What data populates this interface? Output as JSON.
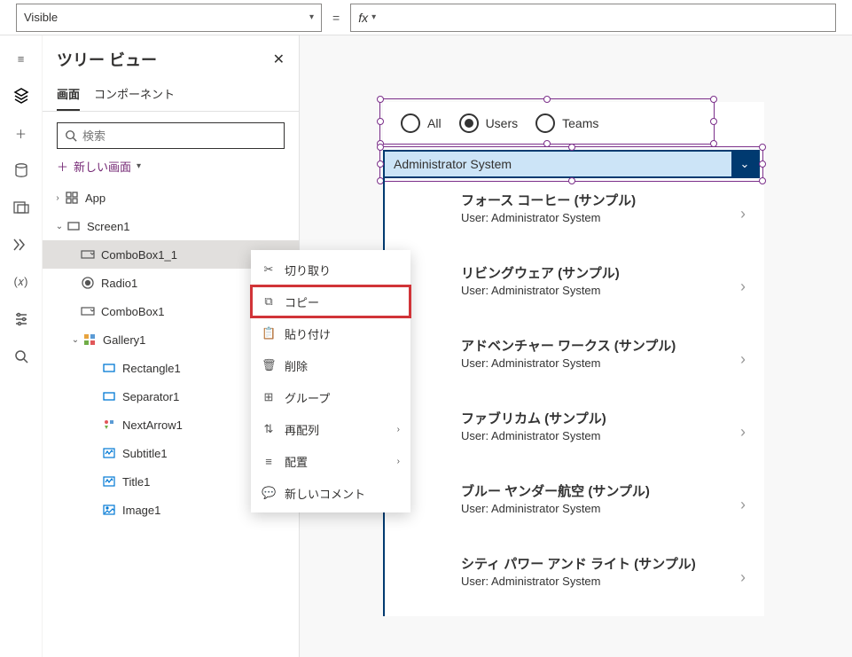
{
  "formula_bar": {
    "property": "Visible",
    "equals": "=",
    "fx_label": "fx",
    "value": ""
  },
  "panel": {
    "title": "ツリー ビュー",
    "tabs": {
      "screens": "画面",
      "components": "コンポーネント"
    },
    "search_placeholder": "検索",
    "new_screen": "新しい画面"
  },
  "tree": {
    "app": "App",
    "screen": "Screen1",
    "items": [
      {
        "id": "combobox1_1",
        "label": "ComboBox1_1"
      },
      {
        "id": "radio1",
        "label": "Radio1"
      },
      {
        "id": "combobox1",
        "label": "ComboBox1"
      },
      {
        "id": "gallery1",
        "label": "Gallery1",
        "children": [
          {
            "id": "rectangle1",
            "label": "Rectangle1"
          },
          {
            "id": "separator1",
            "label": "Separator1"
          },
          {
            "id": "nextarrow1",
            "label": "NextArrow1"
          },
          {
            "id": "subtitle1",
            "label": "Subtitle1"
          },
          {
            "id": "title1",
            "label": "Title1"
          },
          {
            "id": "image1",
            "label": "Image1"
          }
        ]
      }
    ]
  },
  "context_menu": {
    "cut": "切り取り",
    "copy": "コピー",
    "paste": "貼り付け",
    "delete": "削除",
    "group": "グループ",
    "reorder": "再配列",
    "align": "配置",
    "comment": "新しいコメント"
  },
  "preview": {
    "radios": {
      "all": "All",
      "users": "Users",
      "teams": "Teams",
      "selected": "Users"
    },
    "combo_value": "Administrator System",
    "gallery": [
      {
        "title": "フォース コーヒー (サンプル)",
        "subtitle": "User: Administrator System"
      },
      {
        "title": "リビングウェア (サンプル)",
        "subtitle": "User: Administrator System"
      },
      {
        "title": "アドベンチャー ワークス (サンプル)",
        "subtitle": "User: Administrator System"
      },
      {
        "title": "ファブリカム (サンプル)",
        "subtitle": "User: Administrator System"
      },
      {
        "title": "ブルー ヤンダー航空 (サンプル)",
        "subtitle": "User: Administrator System"
      },
      {
        "title": "シティ パワー アンド ライト (サンプル)",
        "subtitle": "User: Administrator System"
      }
    ]
  }
}
